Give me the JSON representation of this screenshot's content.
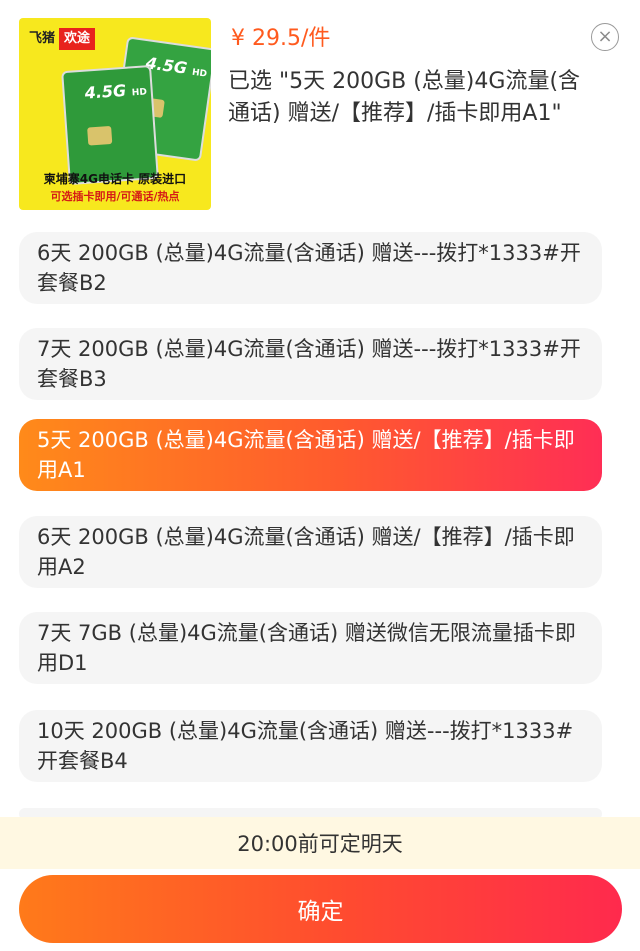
{
  "product": {
    "price": "¥ 29.5/件",
    "selected_text": "已选 \"5天 200GB (总量)4G流量(含通话) 赠送/【推荐】/插卡即用A1\"",
    "thumbnail": {
      "badge_left": "飞猪",
      "badge_right": "欢途",
      "card_label": "4.5G",
      "card_sub": "HD",
      "caption_main": "柬埔寨4G电话卡  原装进口",
      "caption_sub": "可选插卡即用/可通话/热点"
    }
  },
  "close_icon": "×",
  "options": [
    {
      "label": "6天 200GB (总量)4G流量(含通话) 赠送---拨打*1333#开套餐B2",
      "selected": false
    },
    {
      "label": "7天 200GB (总量)4G流量(含通话) 赠送---拨打*1333#开套餐B3",
      "selected": false
    },
    {
      "label": "5天 200GB (总量)4G流量(含通话) 赠送/【推荐】/插卡即用A1",
      "selected": true
    },
    {
      "label": "6天 200GB (总量)4G流量(含通话) 赠送/【推荐】/插卡即用A2",
      "selected": false
    },
    {
      "label": "7天 7GB (总量)4G流量(含通话) 赠送微信无限流量插卡即用D1",
      "selected": false
    },
    {
      "label": "10天 200GB (总量)4G流量(含通话) 赠送---拨打*1333#开套餐B4",
      "selected": false
    }
  ],
  "delivery_notice": "20:00前可定明天",
  "confirm_label": "确定",
  "colors": {
    "accent": "#ff5a1e",
    "thumbnail_bg": "#f7e81e",
    "notice_bg": "#fff8e2"
  }
}
